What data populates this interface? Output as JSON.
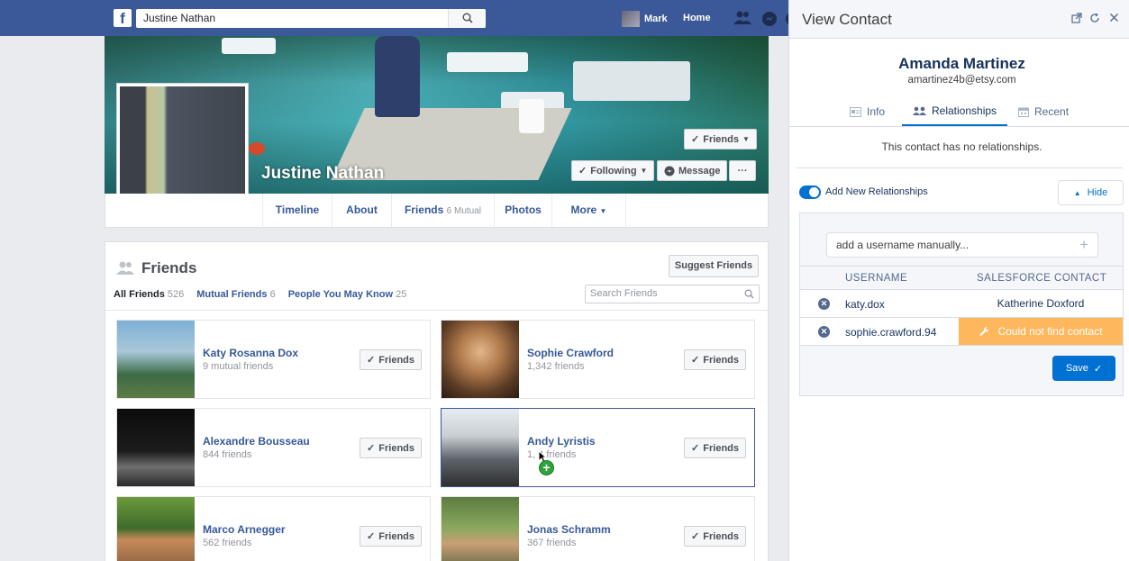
{
  "fb": {
    "logo": "f",
    "search_value": "Justine Nathan",
    "user_name": "Mark",
    "home_label": "Home"
  },
  "profile": {
    "name": "Justine Nathan",
    "friends_btn": "Friends",
    "following_btn": "Following",
    "message_btn": "Message",
    "more_dots": "···",
    "nav": [
      {
        "label": "Timeline"
      },
      {
        "label": "About"
      },
      {
        "label": "Friends",
        "sub": "6 Mutual"
      },
      {
        "label": "Photos"
      },
      {
        "label": "More"
      }
    ]
  },
  "friends": {
    "title": "Friends",
    "suggest_btn": "Suggest Friends",
    "tabs": [
      {
        "label": "All Friends",
        "count": "526"
      },
      {
        "label": "Mutual Friends",
        "count": "6"
      },
      {
        "label": "People You May Know",
        "count": "25"
      }
    ],
    "search_placeholder": "Search Friends",
    "button_label": "Friends",
    "cards": [
      {
        "name": "Katy Rosanna Dox",
        "sub": "9 mutual friends"
      },
      {
        "name": "Sophie Crawford",
        "sub": "1,342 friends"
      },
      {
        "name": "Alexandre Bousseau",
        "sub": "844 friends"
      },
      {
        "name": "Andy Lyristis",
        "sub": "1,  4 friends"
      },
      {
        "name": "Marco Arnegger",
        "sub": "562 friends"
      },
      {
        "name": "Jonas Schramm",
        "sub": "367 friends"
      }
    ]
  },
  "sf": {
    "header_title": "View Contact",
    "contact_name": "Amanda Martinez",
    "contact_email": "amartinez4b@etsy.com",
    "tabs": [
      {
        "label": "Info"
      },
      {
        "label": "Relationships"
      },
      {
        "label": "Recent"
      }
    ],
    "no_relationships": "This contact has no relationships.",
    "toggle_label": "Add New Relationships",
    "hide_btn": "Hide",
    "add_placeholder": "add a username manually...",
    "col_username": "USERNAME",
    "col_contact": "SALESFORCE CONTACT",
    "rows": [
      {
        "username": "katy.dox",
        "contact": "Katherine Doxford",
        "status": "found"
      },
      {
        "username": "sophie.crawford.94",
        "contact": "Could not find contact",
        "status": "warning"
      }
    ],
    "save_btn": "Save",
    "accent": "#0070d2",
    "warning_color": "#ffb75d"
  }
}
